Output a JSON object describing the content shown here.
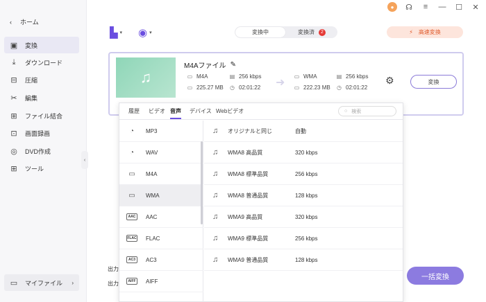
{
  "sidebar": {
    "home_label": "ホーム",
    "items": [
      {
        "label": "変換",
        "icon": "convert-icon",
        "glyph": "▣",
        "active": true
      },
      {
        "label": "ダウンロード",
        "icon": "download-icon",
        "glyph": "⤓",
        "active": false
      },
      {
        "label": "圧縮",
        "icon": "compress-icon",
        "glyph": "⊟",
        "active": false
      },
      {
        "label": "編集",
        "icon": "scissors-icon",
        "glyph": "✂",
        "active": false
      },
      {
        "label": "ファイル結合",
        "icon": "merge-icon",
        "glyph": "⊞",
        "active": false
      },
      {
        "label": "画面録画",
        "icon": "screen-record-icon",
        "glyph": "⊡",
        "active": false
      },
      {
        "label": "DVD作成",
        "icon": "dvd-icon",
        "glyph": "◎",
        "active": false
      },
      {
        "label": "ツール",
        "icon": "tools-icon",
        "glyph": "⊞",
        "active": false
      }
    ],
    "myfile_label": "マイファイル"
  },
  "toolbar": {
    "seg_converting": "変換中",
    "seg_converted": "変換済",
    "converted_badge": "2",
    "fast_convert": "高速変換"
  },
  "file": {
    "name": "M4Aファイル",
    "source": {
      "format": "M4A",
      "bitrate": "256 kbps",
      "size": "225.27 MB",
      "duration": "02:01:22"
    },
    "target": {
      "format": "WMA",
      "bitrate": "256 kbps",
      "size": "222.23 MB",
      "duration": "02:01:22"
    },
    "convert_label": "変換"
  },
  "bottom": {
    "output_label_1": "出力",
    "output_label_2": "出力",
    "bulk_convert": "一括変換"
  },
  "dropdown": {
    "tabs": [
      "履歴",
      "ビデオ",
      "音声",
      "デバイス",
      "Webビデオ"
    ],
    "active_tab": "音声",
    "search_placeholder": "検索",
    "formats": [
      {
        "label": "MP3",
        "icon": "mp3-icon",
        "glyph": "◔",
        "active": false
      },
      {
        "label": "WAV",
        "icon": "wav-icon",
        "glyph": "◔",
        "active": false
      },
      {
        "label": "M4A",
        "icon": "m4a-icon",
        "glyph": "▭",
        "active": false
      },
      {
        "label": "WMA",
        "icon": "wma-icon",
        "glyph": "▭",
        "active": true
      },
      {
        "label": "AAC",
        "icon": "aac-icon",
        "glyph": "AAC",
        "active": false
      },
      {
        "label": "FLAC",
        "icon": "flac-icon",
        "glyph": "FLAC",
        "active": false
      },
      {
        "label": "AC3",
        "icon": "ac3-icon",
        "glyph": "AC3",
        "active": false
      },
      {
        "label": "AIFF",
        "icon": "aiff-icon",
        "glyph": "AIFF",
        "active": false
      }
    ],
    "qualities": [
      {
        "name": "オリジナルと同じ",
        "bitrate": "自動"
      },
      {
        "name": "WMA8 高品質",
        "bitrate": "320 kbps"
      },
      {
        "name": "WMA8 標準品質",
        "bitrate": "256 kbps"
      },
      {
        "name": "WMA8 普通品質",
        "bitrate": "128 kbps"
      },
      {
        "name": "WMA9 高品質",
        "bitrate": "320 kbps"
      },
      {
        "name": "WMA9 標準品質",
        "bitrate": "256 kbps"
      },
      {
        "name": "WMA9 普通品質",
        "bitrate": "128 kbps"
      }
    ]
  }
}
